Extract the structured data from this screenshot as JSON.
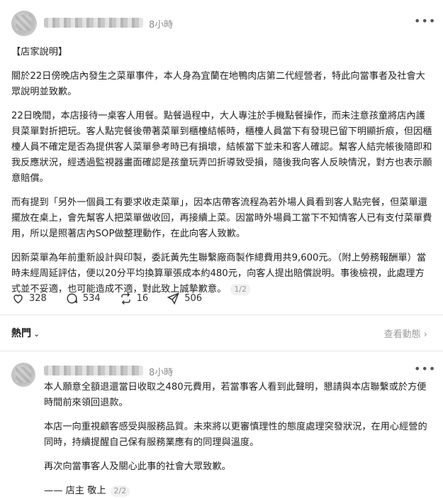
{
  "post": {
    "timestamp": "8小時",
    "more_icon": "more-horizontal-icon",
    "paragraphs": [
      "【店家說明】",
      "關於22日傍晚店內發生之菜單事件，本人身為宜蘭在地鴨肉店第二代經營者，特此向當事者及社會大眾說明並致歉。",
      "22日晚間，本店接待一桌客人用餐。點餐過程中，大人專注於手機點餐操作，而未注意孩童將店內護貝菜單對折把玩。客人點完餐後帶著菜單到櫃檯結帳時，櫃檯人員當下有發現已留下明顯折痕，但因櫃檯人員不確定是否為提供客人菜單參考時已有損壞，結帳當下並未和客人確認。幫客人結完帳後隨即和我反應狀況，經透過監視器畫面確認是孩童玩弄凹折導致受損，隨後我向客人反映情況，對方也表示願意賠償。",
      "而有提到「另外一個員工有要求收走菜單」，因本店帶客流程為若外場人員看到客人點完餐，但菜單還擺放在桌上，會先幫客人把菜單做收回，再接續上菜。因當時外場員工當下不知情客人已有支付菜單費用，所以是照著店內SOP做整理動作，在此向客人致歉。",
      "因新菜單為年前重新設計與印製，委託黃先生聯繫廠商製作總費用共9,600元。（附上勞務報酬單）當時未經周延評估，便以20分平均換算單張成本約480元，向客人提出賠償說明。事後檢視，此處理方式並不妥適，也可能造成不適，對此致上誠摯歉意。"
    ],
    "pager": "1/2",
    "actions": {
      "likes": "328",
      "comments": "534",
      "reposts": "16",
      "shares": "506"
    }
  },
  "sort_bar": {
    "label": "熱門",
    "activity": "查看動態"
  },
  "reply": {
    "timestamp": "8小時",
    "more_icon": "more-horizontal-icon",
    "paragraphs": [
      "本人願意全額退還當日收取之480元費用，若當事客人看到此聲明，懇請與本店聯繫或於方便時間前來領回退款。",
      "本店一向重視顧客感受與服務品質。未來將以更審慎理性的態度處理突發狀況，在用心經營的同時，持續提醒自己保有服務業應有的同理與溫度。",
      "再次向當事客人及關心此事的社會大眾致歉。",
      "—— 店主 敬上"
    ],
    "pager": "2/2"
  }
}
